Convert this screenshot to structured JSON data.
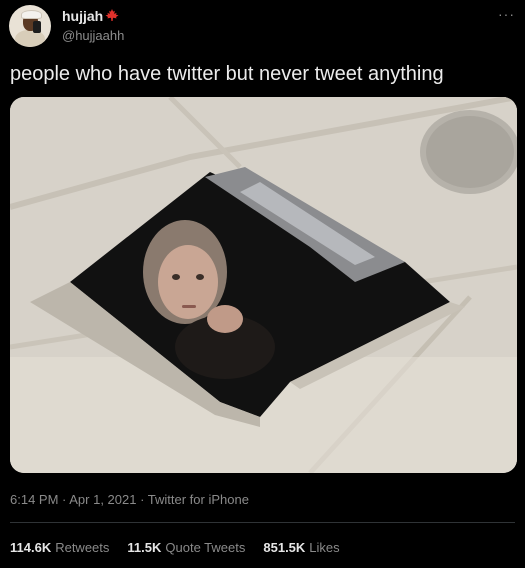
{
  "author": {
    "display_name": "hujjah",
    "handle": "@hujjaahh",
    "flag_icon": "canada-maple-leaf-icon",
    "more_icon": "more-options-icon"
  },
  "tweet": {
    "text": "people who have twitter but never tweet anything",
    "timestamp": "6:14 PM · Apr 1, 2021 · Twitter for iPhone"
  },
  "stats": {
    "retweets_value": "114.6K",
    "retweets_label": "Retweets",
    "quote_value": "11.5K",
    "quote_label": "Quote Tweets",
    "likes_value": "851.5K",
    "likes_label": "Likes"
  },
  "colors": {
    "background": "#000000",
    "text": "#d9d9d9",
    "muted": "#8a8a8a",
    "flag": "#e0312b"
  }
}
